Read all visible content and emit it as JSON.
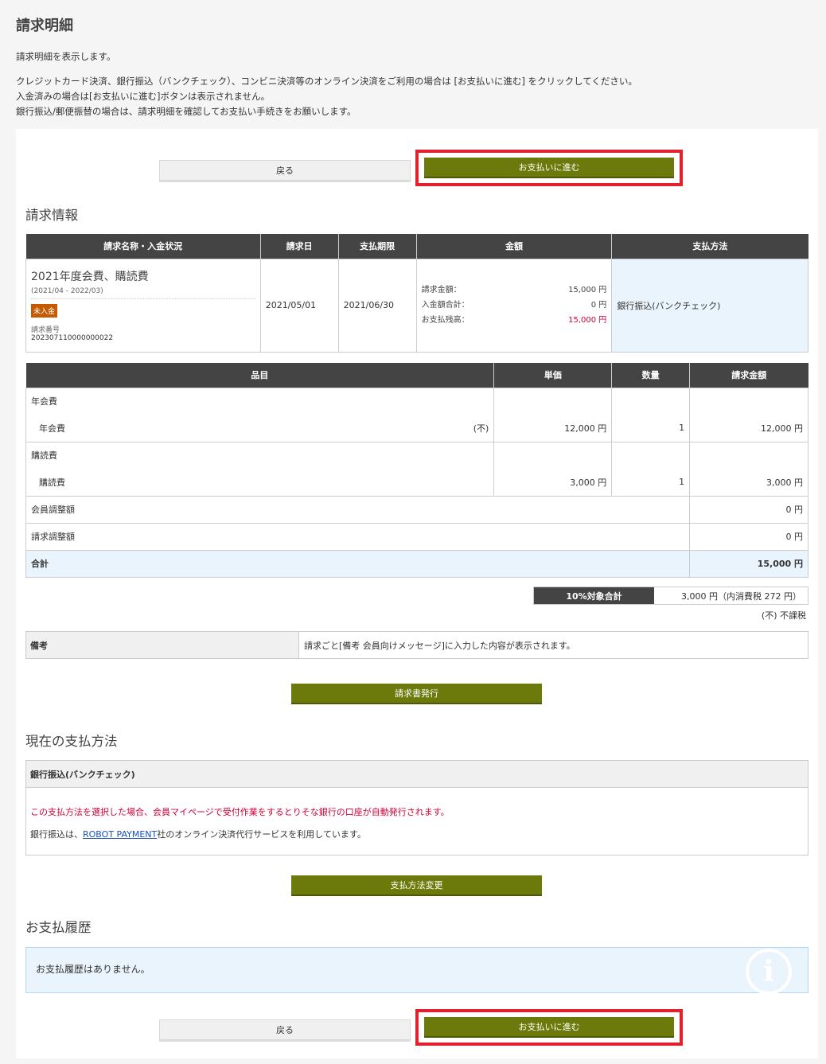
{
  "page": {
    "title": "請求明細",
    "intro": [
      "請求明細を表示します。",
      "クレジットカード決済、銀行振込（バンクチェック）、コンビニ決済等のオンライン決済をご利用の場合は [お支払いに進む] をクリックしてください。",
      "入金済みの場合は[お支払いに進む]ボタンは表示されません。",
      "銀行振込/郵便振替の場合は、請求明細を確認してお支払い手続きをお願いします。"
    ]
  },
  "buttons": {
    "back": "戻る",
    "pay": "お支払いに進む",
    "issue_invoice": "請求書発行",
    "change_method": "支払方法変更"
  },
  "invoice_info": {
    "title": "請求情報",
    "headers": [
      "請求名称・入金状況",
      "請求日",
      "支払期限",
      "金額",
      "支払方法"
    ],
    "name": "2021年度会費、購読費",
    "period": "(2021/04 - 2022/03)",
    "status": "未入金",
    "invoice_no_label": "請求番号",
    "invoice_no": "202307110000000022",
    "invoice_date": "2021/05/01",
    "due_date": "2021/06/30",
    "amounts": {
      "billed_label": "請求金額：",
      "billed": "15,000 円",
      "paid_label": "入金額合計：",
      "paid": "0 円",
      "balance_label": "お支払残高：",
      "balance": "15,000 円"
    },
    "payment_method": "銀行振込(バンクチェック)"
  },
  "items": {
    "headers": [
      "品目",
      "単価",
      "数量",
      "請求金額"
    ],
    "cat1": "年会費",
    "row1": {
      "name": "年会費",
      "tag": "(不)",
      "price": "12,000 円",
      "qty": "1",
      "amount": "12,000 円"
    },
    "cat2": "購読費",
    "row2": {
      "name": "購読費",
      "tag": "",
      "price": "3,000 円",
      "qty": "1",
      "amount": "3,000 円"
    },
    "member_adj_label": "会員調整額",
    "member_adj": "0 円",
    "invoice_adj_label": "請求調整額",
    "invoice_adj": "0 円",
    "total_label": "合計",
    "total": "15,000 円"
  },
  "tax": {
    "label": "10%対象合計",
    "value": "3,000 円（内消費税 272 円）",
    "nontax_note": "(不) 不課税"
  },
  "remark": {
    "label": "備考",
    "value": "請求ごと[備考 会員向けメッセージ]に入力した内容が表示されます。"
  },
  "current_method": {
    "title": "現在の支払方法",
    "name": "銀行振込(バンクチェック)",
    "warning": "この支払方法を選択した場合、会員マイページで受付作業をするとりそな銀行の口座が自動発行されます。",
    "note_prefix": "銀行振込は、",
    "link": "ROBOT PAYMENT",
    "note_suffix": "社のオンライン決済代行サービスを利用しています。"
  },
  "history": {
    "title": "お支払履歴",
    "empty": "お支払履歴はありません。"
  },
  "colors": {
    "olive": "#6b7a0a",
    "highlight_frame": "#e3202e",
    "header_dark": "#444444",
    "light_blue": "#eaf4fd",
    "warning_red": "#d0003a",
    "status_badge": "#c65a00"
  }
}
